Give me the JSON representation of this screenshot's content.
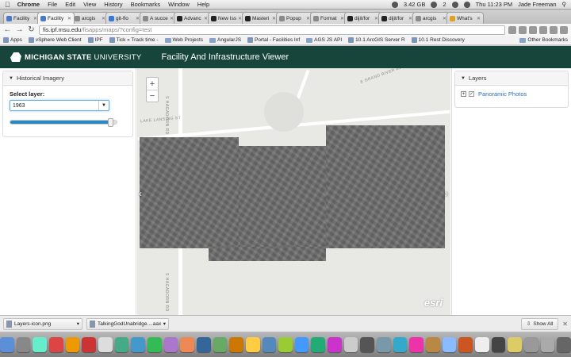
{
  "menubar": {
    "app": "Chrome",
    "menus": [
      "File",
      "Edit",
      "View",
      "History",
      "Bookmarks",
      "Window",
      "Help"
    ],
    "storage": "3.42 GB",
    "tray_number": "2",
    "clock": "Thu 11:23 PM",
    "user": "Jade Freeman"
  },
  "tabs": [
    {
      "label": "Facility",
      "color": "#4a79c7"
    },
    {
      "label": "Facility",
      "color": "#4a79c7"
    },
    {
      "label": "arcgis",
      "color": "#8a8a8a"
    },
    {
      "label": "git-flo",
      "color": "#3a78d8"
    },
    {
      "label": "A succe",
      "color": "#8a8a8a"
    },
    {
      "label": "Advanc",
      "color": "#222222"
    },
    {
      "label": "New Iss",
      "color": "#222222"
    },
    {
      "label": "Masteri",
      "color": "#222222"
    },
    {
      "label": "Popup",
      "color": "#8a8a8a"
    },
    {
      "label": "Format",
      "color": "#8a8a8a"
    },
    {
      "label": "dijit/for",
      "color": "#222222"
    },
    {
      "label": "dijit/for",
      "color": "#222222"
    },
    {
      "label": "arcgis",
      "color": "#8a8a8a"
    },
    {
      "label": "What's",
      "color": "#e0a020"
    }
  ],
  "address": {
    "host": "fis.ipf.msu.edu",
    "path": "/fisapps/maps/?config=test"
  },
  "bookmarks": [
    {
      "label": "Apps",
      "kind": "apps"
    },
    {
      "label": "vSphere Web Client",
      "kind": "link"
    },
    {
      "label": "IPF",
      "kind": "link"
    },
    {
      "label": "Tick » Track time -",
      "kind": "link"
    },
    {
      "label": "Web Projects",
      "kind": "folder"
    },
    {
      "label": "AngularJS",
      "kind": "folder"
    },
    {
      "label": "Portal - Facilities Inf",
      "kind": "link"
    },
    {
      "label": "AGS JS API",
      "kind": "folder"
    },
    {
      "label": "10.1 ArcGIS Server R",
      "kind": "link"
    },
    {
      "label": "10.1 Rest Discovery",
      "kind": "link"
    }
  ],
  "other_bookmarks": "Other Bookmarks",
  "header": {
    "logo_bold": "MICHIGAN STATE",
    "logo_regular": " UNIVERSITY",
    "title": "Facility And Infrastructure Viewer"
  },
  "left_panel": {
    "title": "Historical Imagery",
    "select_label": "Select layer:",
    "selected_layer": "1963",
    "opacity": 0.94
  },
  "map": {
    "zoom_in": "+",
    "zoom_out": "−",
    "prev": "‹",
    "next": "›",
    "attribution": "esri",
    "road_labels": [
      "E GRAND RIVER AVE",
      "LAKE LANSING ST",
      "S HAGADORN RD",
      "S HAGADORN RD"
    ]
  },
  "right_panel": {
    "title": "Layers",
    "layers": [
      {
        "label": "Panoramic Photos",
        "checked": true
      }
    ]
  },
  "downloads": {
    "items": [
      "Layers-icon.png",
      "TalkingGodUnabridge....aax"
    ],
    "show_all": "Show All"
  },
  "dock": {
    "icon_colors": [
      "#5b8fd8",
      "#888",
      "#6ec",
      "#d44",
      "#e90",
      "#c33",
      "#ddd",
      "#4a8",
      "#49c",
      "#3b5",
      "#a7c",
      "#e85",
      "#369",
      "#6a6",
      "#c70",
      "#fc4",
      "#58b",
      "#9c3",
      "#49f",
      "#2a7",
      "#c3c",
      "#ccc",
      "#555",
      "#79a",
      "#3ac",
      "#e3a",
      "#b84",
      "#8bf",
      "#c52",
      "#eee",
      "#444",
      "#dc6",
      "#999",
      "#aaa",
      "#666"
    ]
  }
}
